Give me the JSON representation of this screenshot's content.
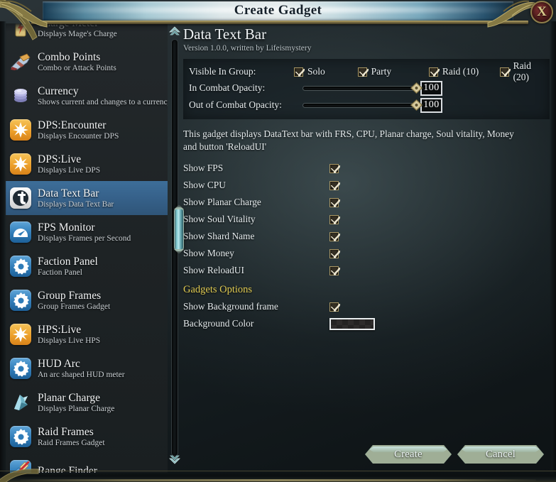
{
  "window": {
    "title": "Create Gadget",
    "close_icon": "close-x-icon",
    "close_label": "X"
  },
  "sidebar": {
    "scroll_up_icon": "chevron-up-icon",
    "scroll_down_icon": "chevron-down-icon",
    "items": [
      {
        "name": "Charge Meter",
        "desc": "Displays Mage's Charge",
        "icon": "charge-meter-icon",
        "style": "dark",
        "selected": false,
        "partial": true
      },
      {
        "name": "Combo Points",
        "desc": "Combo or Attack Points",
        "icon": "combo-points-icon",
        "style": "dark",
        "selected": false
      },
      {
        "name": "Currency",
        "desc": "Shows current and changes to a currency",
        "icon": "currency-icon",
        "style": "dark",
        "selected": false
      },
      {
        "name": "DPS:Encounter",
        "desc": "Displays Encounter DPS",
        "icon": "starburst-icon",
        "style": "orange",
        "selected": false
      },
      {
        "name": "DPS:Live",
        "desc": "Displays Live DPS",
        "icon": "starburst-icon",
        "style": "orange",
        "selected": false
      },
      {
        "name": "Data Text Bar",
        "desc": "Displays Data Text Bar",
        "icon": "data-text-bar-icon",
        "style": "white",
        "selected": true
      },
      {
        "name": "FPS Monitor",
        "desc": "Displays Frames per Second",
        "icon": "gauge-icon",
        "style": "blue",
        "selected": false
      },
      {
        "name": "Faction Panel",
        "desc": "Faction Panel",
        "icon": "gear-icon",
        "style": "blue",
        "selected": false
      },
      {
        "name": "Group Frames",
        "desc": "Group Frames Gadget",
        "icon": "gear-icon",
        "style": "blue",
        "selected": false
      },
      {
        "name": "HPS:Live",
        "desc": "Displays Live HPS",
        "icon": "starburst-icon",
        "style": "orange",
        "selected": false
      },
      {
        "name": "HUD Arc",
        "desc": "An arc shaped HUD meter",
        "icon": "gear-icon",
        "style": "blue",
        "selected": false
      },
      {
        "name": "Planar Charge",
        "desc": "Displays Planar Charge",
        "icon": "crystal-icon",
        "style": "dark",
        "selected": false
      },
      {
        "name": "Raid Frames",
        "desc": "Raid Frames Gadget",
        "icon": "gear-icon",
        "style": "blue",
        "selected": false
      },
      {
        "name": "Range Finder",
        "desc": "",
        "icon": "range-finder-icon",
        "style": "blue",
        "selected": false
      }
    ]
  },
  "detail": {
    "title": "Data Text Bar",
    "subtitle": "Version 1.0.0, written by Lifeismystery",
    "description": "This gadget displays DataText bar with FRS, CPU, Planar charge, Soul vitality, Money and button 'ReloadUI'",
    "visibility": {
      "label": "Visible In Group:",
      "groups": [
        {
          "label": "Solo",
          "checked": true
        },
        {
          "label": "Party",
          "checked": true
        },
        {
          "label": "Raid (10)",
          "checked": true
        },
        {
          "label": "Raid (20)",
          "checked": true
        }
      ]
    },
    "sliders": [
      {
        "label": "In Combat Opacity:",
        "value": "100",
        "percent": 100
      },
      {
        "label": "Out of Combat Opacity:",
        "value": "100",
        "percent": 100
      }
    ],
    "options": [
      {
        "label": "Show FPS",
        "checked": true
      },
      {
        "label": "Show CPU",
        "checked": true
      },
      {
        "label": "Show Planar Charge",
        "checked": true
      },
      {
        "label": "Show Soul Vitality",
        "checked": true
      },
      {
        "label": "Show Shard Name",
        "checked": true
      },
      {
        "label": "Show Money",
        "checked": true
      },
      {
        "label": "Show ReloadUI",
        "checked": true
      }
    ],
    "gadget_options": {
      "heading": "Gadgets Options",
      "heading_color": "#e0cb52",
      "show_background_frame": {
        "label": "Show Background frame",
        "checked": true
      },
      "background_color": {
        "label": "Background Color",
        "value": "#2a2827"
      }
    }
  },
  "footer": {
    "create_label": "Create",
    "cancel_label": "Cancel"
  }
}
